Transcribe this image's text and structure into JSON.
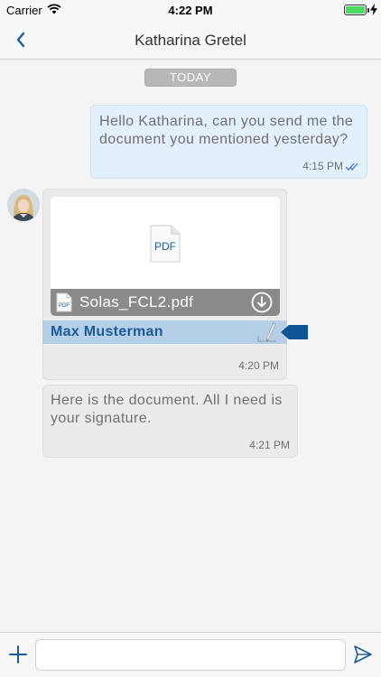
{
  "status_bar": {
    "carrier": "Carrier",
    "time": "4:22 PM",
    "battery_level": 1.0,
    "icons": [
      "wifi-icon",
      "battery-icon",
      "charging-bolt-icon"
    ]
  },
  "nav": {
    "title": "Katharina Gretel",
    "back_icon": "chevron-left-icon"
  },
  "date_separator": "TODAY",
  "messages": [
    {
      "direction": "outgoing",
      "text": "Hello Katharina, can you send me the document you mentioned yesterday?",
      "time": "4:15 PM",
      "status_icon": "double-check-icon"
    },
    {
      "direction": "incoming",
      "attachment": {
        "preview_label": "PDF",
        "icon_label": "PDF",
        "filename": "Solas_FCL2.pdf",
        "download_icon": "download-icon"
      },
      "signer": "Max Musterman",
      "signature_icon": "signature-pen-icon",
      "time": "4:20 PM"
    },
    {
      "direction": "incoming",
      "text": "Here is the document. All I need is your signature.",
      "time": "4:21 PM"
    }
  ],
  "composer": {
    "placeholder": "",
    "add_icon": "plus-icon",
    "send_icon": "send-icon"
  },
  "colors": {
    "accent": "#1e5a96",
    "outgoing_bubble": "#e3f0fb",
    "incoming_bubble": "#ebebeb",
    "signer_highlight": "#b5cfe6",
    "date_chip": "#b8b8b8",
    "battery": "#4cd964"
  }
}
